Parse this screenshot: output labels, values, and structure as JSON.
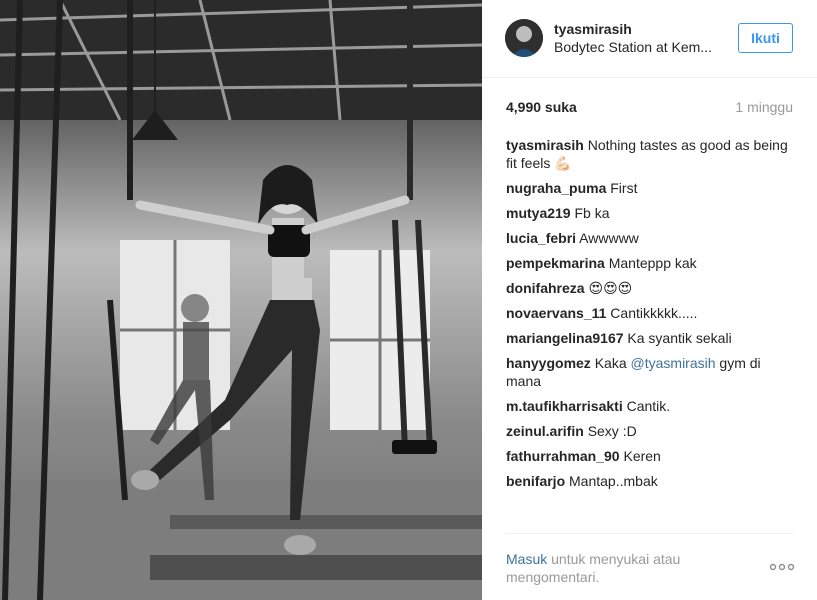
{
  "post": {
    "username": "tyasmirasih",
    "location": "Bodytec Station at Kem...",
    "follow_label": "Ikuti",
    "likes": "4,990 suka",
    "time": "1 minggu"
  },
  "comments": [
    {
      "user": "tyasmirasih",
      "text": "Nothing tastes as good as being fit feels 💪🏻"
    },
    {
      "user": "nugraha_puma",
      "text": "First"
    },
    {
      "user": "mutya219",
      "text": "Fb ka"
    },
    {
      "user": "lucia_febri",
      "text": "Awwwww"
    },
    {
      "user": "pempekmarina",
      "text": "Manteppp kak"
    },
    {
      "user": "donifahreza",
      "text": "😍😍😍"
    },
    {
      "user": "novaervans_11",
      "text": "Cantikkkkk....."
    },
    {
      "user": "mariangelina9167",
      "text": "Ka syantik sekali"
    },
    {
      "user": "hanyygomez",
      "text_before": "Kaka ",
      "mention": "@tyasmirasih",
      "text_after": " gym di mana"
    },
    {
      "user": "m.taufikharrisakti",
      "text": "Cantik."
    },
    {
      "user": "zeinul.arifin",
      "text": "Sexy :D"
    },
    {
      "user": "fathurrahman_90",
      "text": "Keren"
    },
    {
      "user": "benifarjo",
      "text": "Mantap..mbak"
    }
  ],
  "footer": {
    "login_link": "Masuk",
    "login_text": " untuk menyukai atau mengomentari.",
    "more_icon": "ooo"
  },
  "colors": {
    "accent": "#3897f0",
    "link": "#3f729b",
    "muted": "#999999"
  }
}
